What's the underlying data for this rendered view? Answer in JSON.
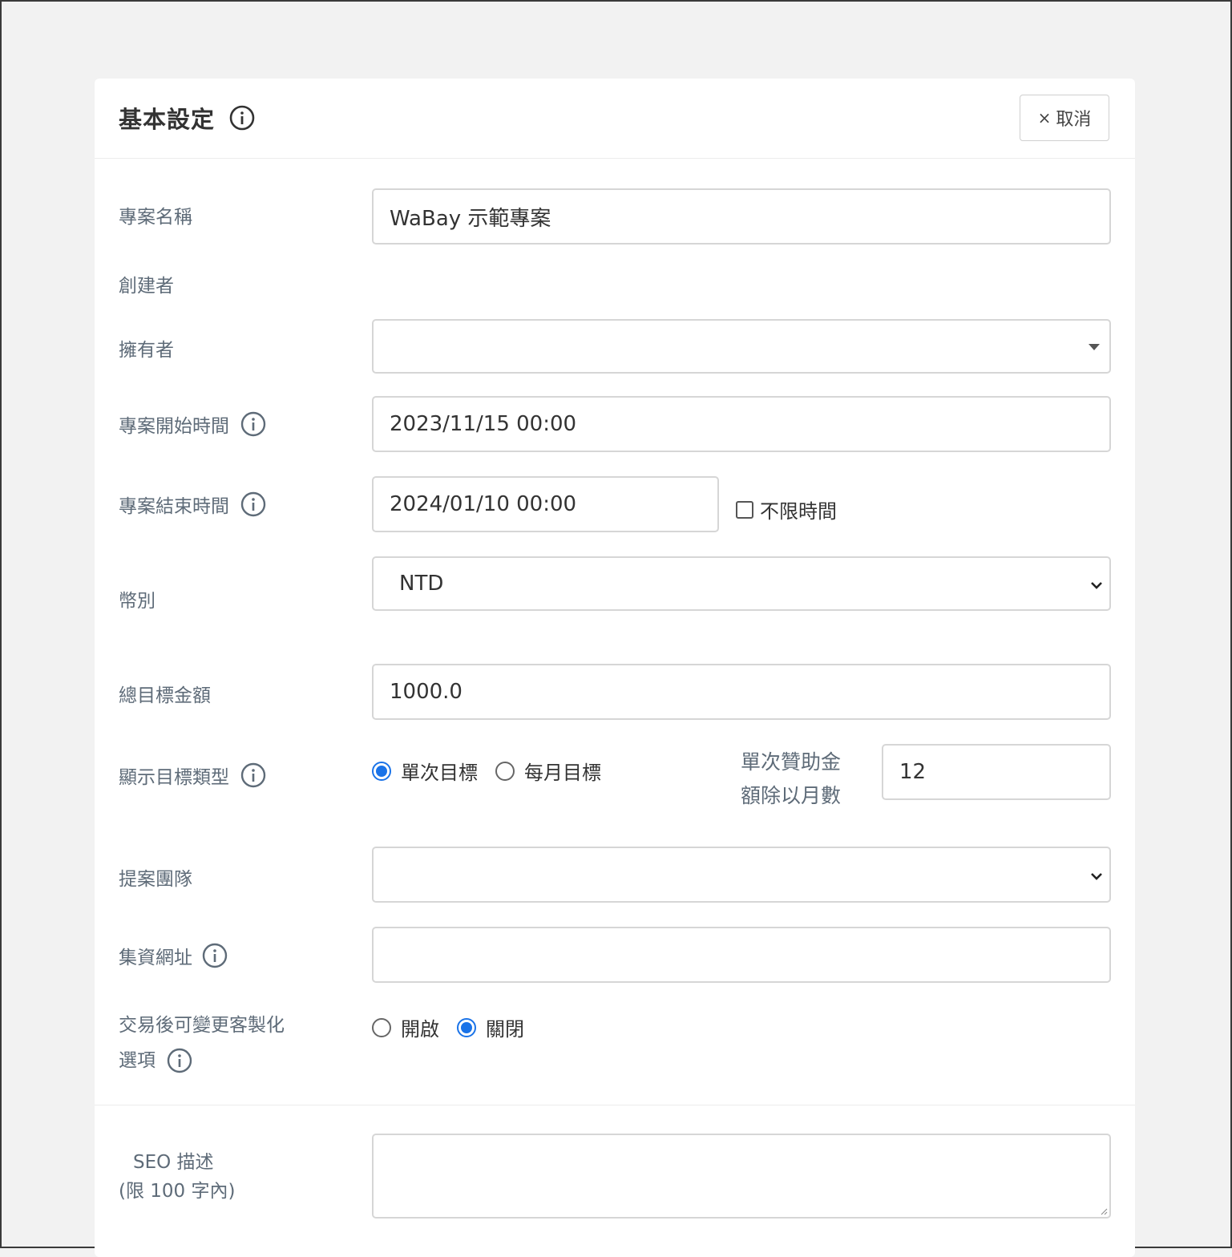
{
  "header": {
    "title": "基本設定",
    "cancel_label": "取消",
    "cancel_icon": "×"
  },
  "fields": {
    "project_name": {
      "label": "專案名稱",
      "value": "WaBay 示範專案"
    },
    "creator": {
      "label": "創建者"
    },
    "owner": {
      "label": "擁有者",
      "value": ""
    },
    "start_time": {
      "label": "專案開始時間",
      "value": "2023/11/15 00:00"
    },
    "end_time": {
      "label": "專案結束時間",
      "value": "2024/01/10 00:00",
      "unlimited_label": "不限時間"
    },
    "currency": {
      "label": "幣別",
      "value": "NTD"
    },
    "target_amount": {
      "label": "總目標金額",
      "value": "1000.0"
    },
    "target_type": {
      "label": "顯示目標類型",
      "options": [
        "單次目標",
        "每月目標"
      ],
      "selected": "單次目標",
      "monthly_divisor_label_line1": "單次贊助金",
      "monthly_divisor_label_line2": "額除以月數",
      "monthly_divisor_value": "12"
    },
    "team": {
      "label": "提案團隊",
      "value": ""
    },
    "funding_url": {
      "label": "集資網址",
      "value": ""
    },
    "custom_options": {
      "label_line1": "交易後可變更客製化",
      "label_line2": "選項",
      "options": [
        "開啟",
        "關閉"
      ],
      "selected": "關閉"
    },
    "seo": {
      "label_line1": "SEO 描述",
      "label_line2": "(限 100 字內)",
      "value": ""
    }
  },
  "colors": {
    "accent": "#1a73e8",
    "label": "#5e6b78",
    "border": "#d6d6d6",
    "background": "#f2f2f2"
  },
  "icons": {
    "info": "info-circle-icon",
    "select": "caret-down-icon",
    "chevron": "chevron-down-icon"
  }
}
